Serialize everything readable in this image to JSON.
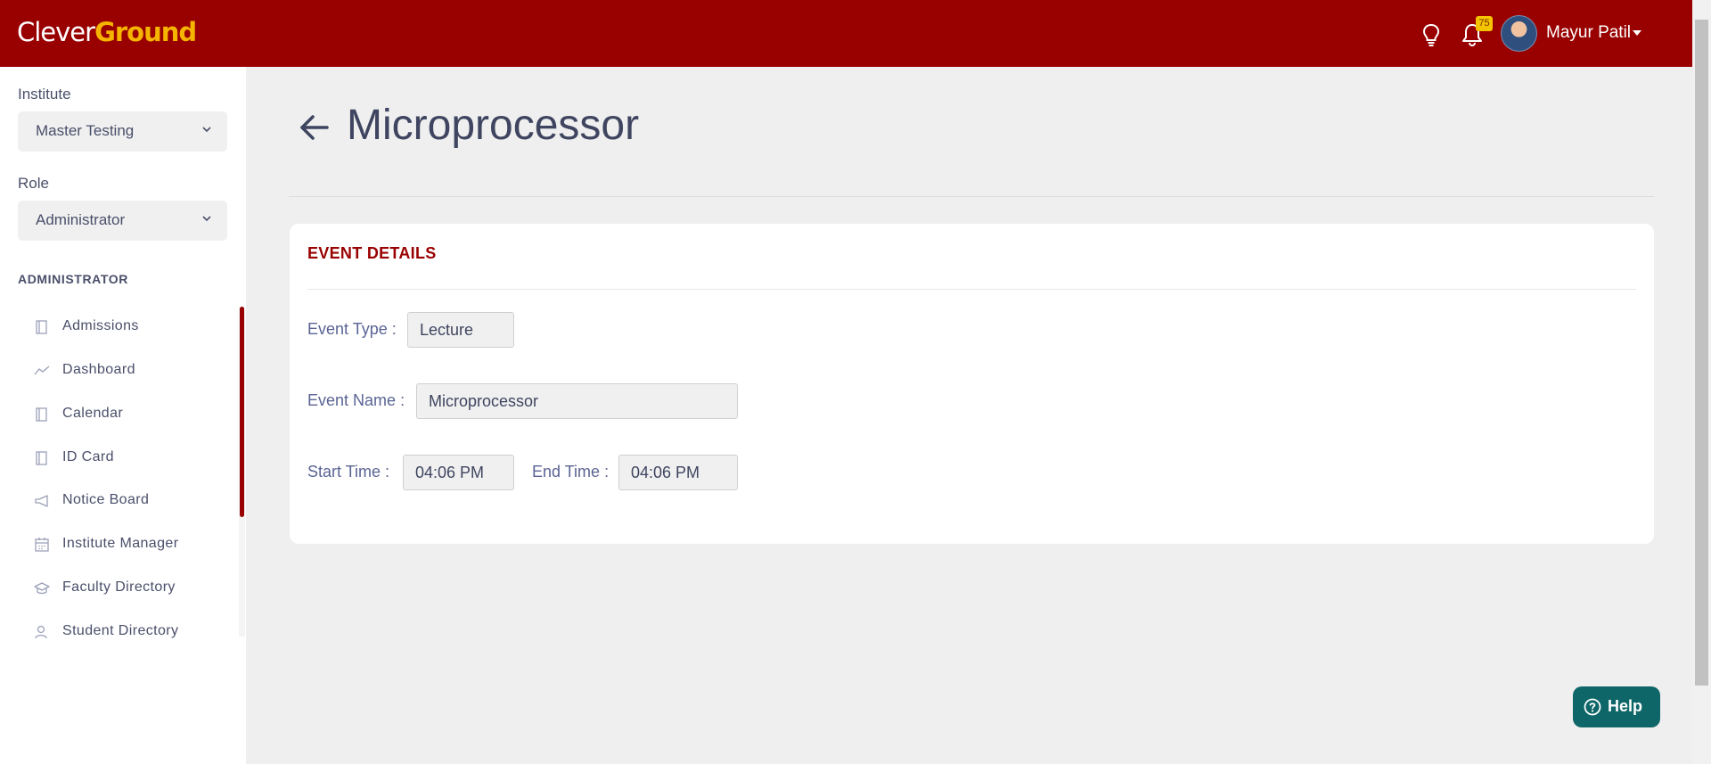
{
  "header": {
    "logo_part1": "Clever",
    "logo_part2": "Ground",
    "notification_count": "75",
    "user_name": "Mayur Patil"
  },
  "sidebar": {
    "institute_label": "Institute",
    "institute_value": "Master Testing",
    "role_label": "Role",
    "role_value": "Administrator",
    "section_heading": "ADMINISTRATOR",
    "items": [
      {
        "label": "Admissions",
        "icon": "book-icon"
      },
      {
        "label": "Dashboard",
        "icon": "trend-line-icon"
      },
      {
        "label": "Calendar",
        "icon": "book-icon"
      },
      {
        "label": "ID Card",
        "icon": "book-icon"
      },
      {
        "label": "Notice Board",
        "icon": "megaphone-icon"
      },
      {
        "label": "Institute Manager",
        "icon": "calendar-grid-icon"
      },
      {
        "label": "Faculty Directory",
        "icon": "graduation-cap-icon"
      },
      {
        "label": "Student Directory",
        "icon": "users-icon"
      }
    ]
  },
  "main": {
    "page_title": "Microprocessor",
    "card_title": "EVENT DETAILS",
    "event_type_label": "Event Type",
    "event_type_value": "Lecture",
    "event_name_label": "Event Name",
    "event_name_value": "Microprocessor",
    "start_time_label": "Start Time",
    "start_time_value": "04:06 PM",
    "end_time_label": "End Time",
    "end_time_value": "04:06 PM",
    "label_separator": ":"
  },
  "help": {
    "label": "Help"
  },
  "colors": {
    "brand": "#990000",
    "logo_accent": "#f5b400",
    "help_button": "#0e6668",
    "badge": "#f5c400"
  }
}
